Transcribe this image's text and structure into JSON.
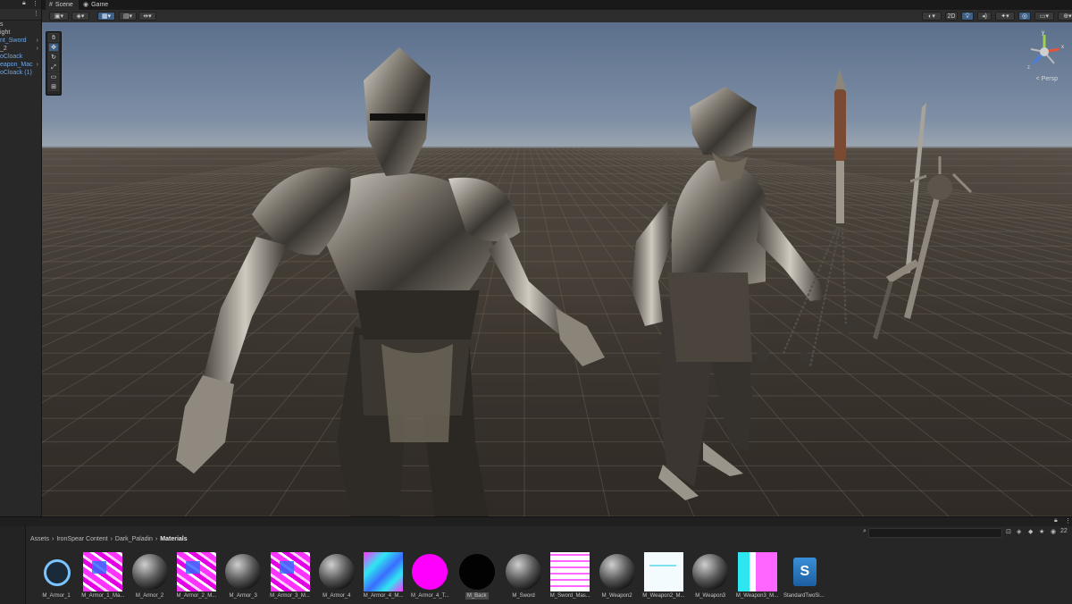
{
  "hierarchy": {
    "items": [
      {
        "label": "s",
        "color": "white",
        "arrow": ""
      },
      {
        "label": "ight",
        "color": "white",
        "arrow": ""
      },
      {
        "label": "nt_Sword",
        "color": "blue",
        "arrow": "›"
      },
      {
        "label": "_2",
        "color": "white",
        "arrow": "›"
      },
      {
        "label": "oCloack",
        "color": "blue",
        "arrow": ""
      },
      {
        "label": "eapon_Mac",
        "color": "blue",
        "arrow": "›"
      },
      {
        "label": "oCloack (1)",
        "color": "blue",
        "arrow": ""
      }
    ]
  },
  "tabs": [
    {
      "label": "Scene",
      "icon": "hash-icon"
    },
    {
      "label": "Game",
      "icon": "gamepad-icon"
    }
  ],
  "toolbar": {
    "mode_2d": "2D"
  },
  "viewport": {
    "projection": "< Persp",
    "gizmo_axes": {
      "y": "y",
      "x": "x",
      "z": "z"
    }
  },
  "project": {
    "breadcrumbs": [
      "Assets",
      "IronSpear Content",
      "Dark_Paladin"
    ],
    "breadcrumb_current": "Materials",
    "sep": "›",
    "count": "22",
    "assets": [
      {
        "label": "M_Armor_1",
        "kind": "ring"
      },
      {
        "label": "M_Armor_1_Ma...",
        "kind": "pinkmask"
      },
      {
        "label": "M_Armor_2",
        "kind": "metal"
      },
      {
        "label": "M_Armor_2_M...",
        "kind": "pinkmask"
      },
      {
        "label": "M_Armor_3",
        "kind": "metal"
      },
      {
        "label": "M_Armor_3_M...",
        "kind": "pinkmask"
      },
      {
        "label": "M_Armor_4",
        "kind": "metal"
      },
      {
        "label": "M_Armor_4_M...",
        "kind": "cyanmask"
      },
      {
        "label": "M_Armor_4_T...",
        "kind": "magentasphere"
      },
      {
        "label": "M_Back",
        "kind": "blacksphere",
        "selected": true
      },
      {
        "label": "M_Sword",
        "kind": "metal"
      },
      {
        "label": "M_Sword_Mas...",
        "kind": "whitemask"
      },
      {
        "label": "M_Weapon2",
        "kind": "metal"
      },
      {
        "label": "M_Weapon2_M...",
        "kind": "whitemask2"
      },
      {
        "label": "M_Weapon3",
        "kind": "metal"
      },
      {
        "label": "M_Weapon3_M...",
        "kind": "cyanmask2"
      },
      {
        "label": "StandardTwoSi...",
        "kind": "shader",
        "glyph": "S"
      }
    ]
  },
  "colors": {
    "accent": "#3e5f86",
    "magenta": "#ff00ff",
    "cyan": "#2ee6f0"
  }
}
